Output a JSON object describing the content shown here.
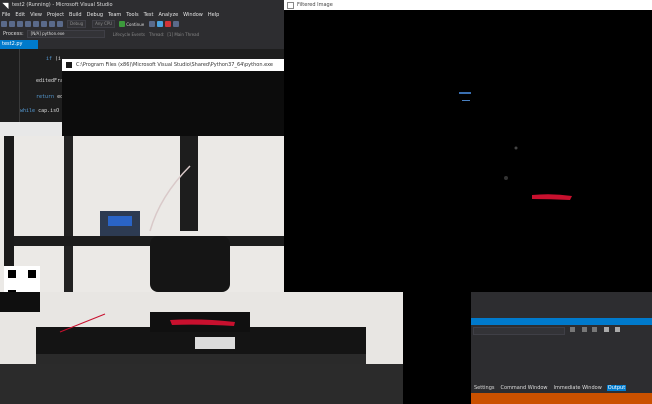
{
  "vs": {
    "title": "test2 (Running) - Microsoft Visual Studio",
    "menu": [
      "File",
      "Edit",
      "View",
      "Project",
      "Build",
      "Debug",
      "Team",
      "Tools",
      "Test",
      "Analyze",
      "Window",
      "Help"
    ],
    "toolbar": {
      "config": "Debug",
      "platform": "Any CPU",
      "continue": "Continue"
    },
    "process_label": "Process:",
    "process_value": "[N/A] python.exe",
    "lifecycle": "Lifecycle Events",
    "thread_label": "Thread:",
    "thread_value": "[1] Main Thread",
    "tab": "test2.py",
    "code": {
      "line1_kw": "if",
      "line1_rest": " (i",
      "line2": "editedFra",
      "line3_kw": "return",
      "line3_rest": " ed",
      "line4_kw": "while",
      "line4_rest": " cap.isO"
    }
  },
  "console": {
    "title": "C:\\Program Files (x86)\\Microsoft Visual Studio\\Shared\\Python37_64\\python.exe"
  },
  "filtered": {
    "title": "Filtered Image"
  },
  "output": {
    "tabs": [
      "Settings",
      "Command Window",
      "Immediate Window",
      "Output"
    ],
    "active_tab": "Output"
  },
  "colors": {
    "vs_bg": "#2d2d30",
    "vs_accent": "#007acc",
    "vs_status_running": "#ca5100",
    "filament_red": "#c8102e"
  }
}
